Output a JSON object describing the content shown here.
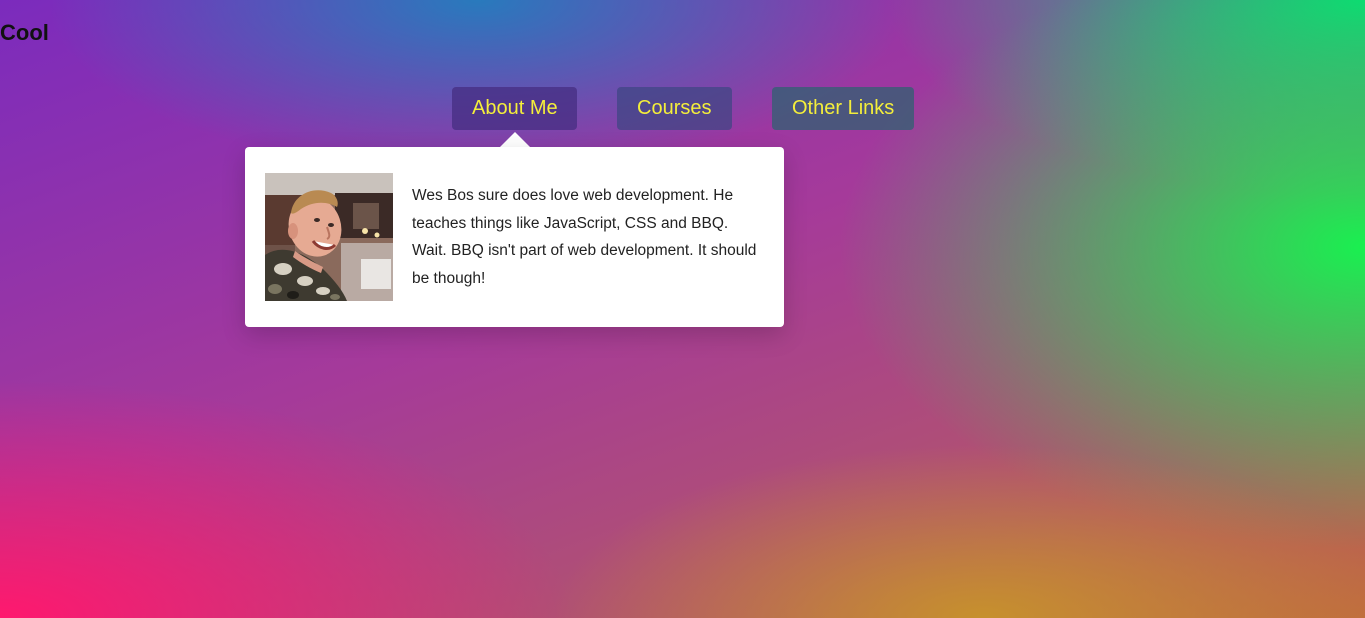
{
  "site": {
    "title": "Cool"
  },
  "nav": {
    "items": [
      {
        "label": "About Me"
      },
      {
        "label": "Courses"
      },
      {
        "label": "Other Links"
      }
    ],
    "text_color": "#f4ee3b"
  },
  "dropdown": {
    "bio": "Wes Bos sure does love web development. He teaches things like JavaScript, CSS and BBQ. Wait. BBQ isn't part of web development. It should be though!",
    "photo_icon": "profile-photo"
  }
}
